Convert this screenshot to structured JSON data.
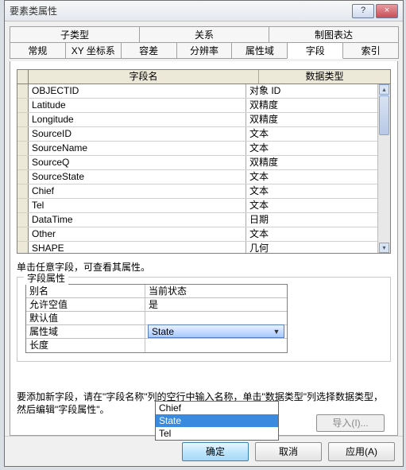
{
  "window": {
    "title": "要素类属性",
    "help_btn": "?",
    "close_btn": "×"
  },
  "tabs": {
    "row1": [
      "子类型",
      "关系",
      "制图表达"
    ],
    "row2": [
      "常规",
      "XY 坐标系",
      "容差",
      "分辨率",
      "属性域",
      "字段",
      "索引"
    ],
    "active": "字段"
  },
  "fields_grid": {
    "header": {
      "name": "字段名",
      "type": "数据类型"
    },
    "rows": [
      {
        "name": "OBJECTID",
        "type": "对象 ID"
      },
      {
        "name": "Latitude",
        "type": "双精度"
      },
      {
        "name": "Longitude",
        "type": "双精度"
      },
      {
        "name": "SourceID",
        "type": "文本"
      },
      {
        "name": "SourceName",
        "type": "文本"
      },
      {
        "name": "SourceQ",
        "type": "双精度"
      },
      {
        "name": "SourceState",
        "type": "文本"
      },
      {
        "name": "Chief",
        "type": "文本"
      },
      {
        "name": "Tel",
        "type": "文本"
      },
      {
        "name": "DataTime",
        "type": "日期"
      },
      {
        "name": "Other",
        "type": "文本"
      },
      {
        "name": "SHAPE",
        "type": "几何"
      }
    ]
  },
  "hint": "单击任意字段，可查看其属性。",
  "prop_group": {
    "title": "字段属性",
    "rows": [
      {
        "label": "别名",
        "value": "当前状态",
        "kind": "text"
      },
      {
        "label": "允许空值",
        "value": "是",
        "kind": "text"
      },
      {
        "label": "默认值",
        "value": "",
        "kind": "text"
      },
      {
        "label": "属性域",
        "value": "State",
        "kind": "combo"
      },
      {
        "label": "长度",
        "value": "",
        "kind": "text"
      }
    ]
  },
  "dropdown": {
    "options": [
      "Chief",
      "State",
      "Tel"
    ],
    "selected": "State"
  },
  "import_btn": "导入(I)...",
  "help_text": "要添加新字段，请在\"字段名称\"列的空行中输入名称，单击\"数据类型\"列选择数据类型，然后编辑\"字段属性\"。",
  "footer": {
    "ok": "确定",
    "cancel": "取消",
    "apply": "应用(A)"
  }
}
